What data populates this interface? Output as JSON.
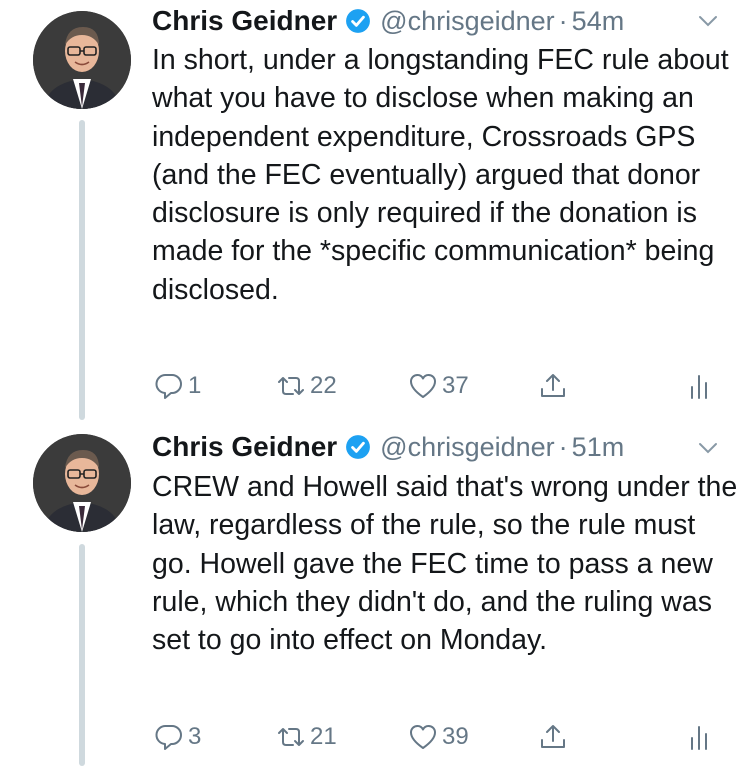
{
  "tweets": [
    {
      "author_name": "Chris Geidner",
      "handle": "@chrisgeidner",
      "time": "54m",
      "text": "In short, under a longstanding FEC rule about what you have to disclose when making an independent expenditure, Crossroads GPS (and the FEC eventually) argued that donor disclosure is only required if the donation is made for the *specific communication* being disclosed.",
      "replies": "1",
      "retweets": "22",
      "likes": "37"
    },
    {
      "author_name": "Chris Geidner",
      "handle": "@chrisgeidner",
      "time": "51m",
      "text": "CREW and Howell said that's wrong under the law, regardless of the rule, so the rule must go. Howell gave the FEC time to pass a new rule, which they didn't do, and the ruling was set to go into effect on Monday.",
      "replies": "3",
      "retweets": "21",
      "likes": "39"
    }
  ],
  "separator": "·",
  "icons": [
    "verified-badge-icon",
    "chevron-down-icon",
    "reply-icon",
    "retweet-icon",
    "like-icon",
    "share-icon",
    "analytics-icon"
  ],
  "colors": {
    "verified": "#1da1f2",
    "muted": "#657786",
    "text": "#14171a",
    "thread_line": "#cfd9de"
  }
}
